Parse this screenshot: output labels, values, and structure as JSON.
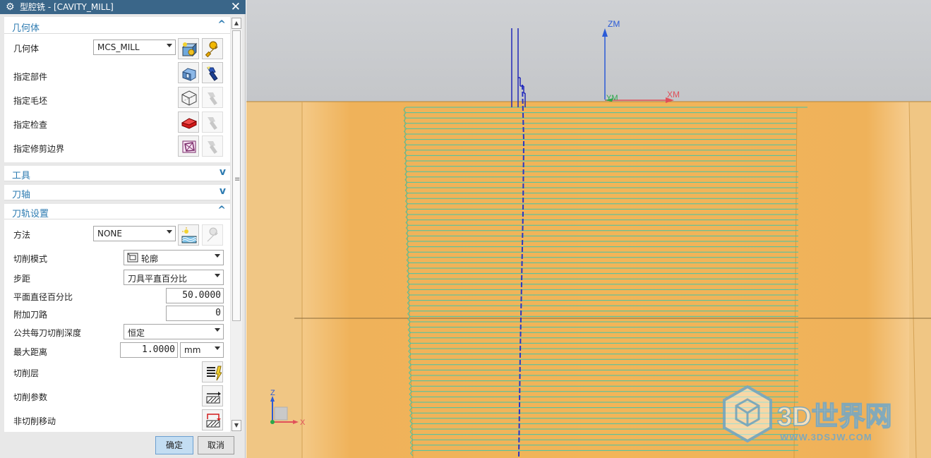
{
  "window": {
    "title": "型腔铣 - [CAVITY_MILL]",
    "title_icon": "gear-icon",
    "close_glyph": "✕"
  },
  "sections": {
    "geometry": {
      "label": "几何体",
      "expanded": true
    },
    "tool": {
      "label": "工具",
      "expanded": false
    },
    "axis": {
      "label": "刀轴",
      "expanded": false
    },
    "path_settings": {
      "label": "刀轨设置",
      "expanded": true
    }
  },
  "geometry": {
    "geometry_label": "几何体",
    "geometry_value": "MCS_MILL",
    "part_label": "指定部件",
    "blank_label": "指定毛坯",
    "check_label": "指定检查",
    "trim_label": "指定修剪边界"
  },
  "path_settings": {
    "method_label": "方法",
    "method_value": "NONE",
    "cut_pattern_label": "切削模式",
    "cut_pattern_value": "轮廓",
    "stepover_label": "步距",
    "stepover_value": "刀具平直百分比",
    "flat_diameter_label": "平面直径百分比",
    "flat_diameter_value": "50.0000",
    "additional_passes_label": "附加刀路",
    "additional_passes_value": "0",
    "depth_per_cut_label": "公共每刀切削深度",
    "depth_per_cut_value": "恒定",
    "max_distance_label": "最大距离",
    "max_distance_value": "1.0000",
    "max_distance_unit": "mm",
    "cut_levels_label": "切削层",
    "cut_params_label": "切削参数",
    "non_cutting_label": "非切削移动"
  },
  "buttons": {
    "ok": "确定",
    "cancel": "取消"
  },
  "viewport": {
    "mcs_z": "ZM",
    "mcs_x": "XM",
    "mcs_y": "YM",
    "triad_z": "Z",
    "triad_x": "X",
    "watermark_title": "3D世界网",
    "watermark_url": "WWW.3DSJW.COM"
  },
  "colors": {
    "title_bar": "#3a6689",
    "section_text": "#2d7bb1",
    "part_orange": "#f1b254",
    "toolpath": "#44c4a8",
    "tool_blue": "#2a35c4",
    "axis_blue": "#2b5bd7",
    "axis_red": "#e0505a",
    "axis_green": "#2aa84a"
  }
}
